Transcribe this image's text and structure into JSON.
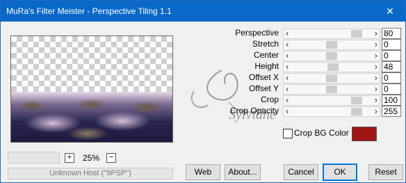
{
  "window": {
    "title": "MuRa's Filter Meister - Perspective Tiling 1.1",
    "close_glyph": "✕"
  },
  "params": [
    {
      "label": "Perspective",
      "value": "80",
      "level": 0.88
    },
    {
      "label": "Stretch",
      "value": "0",
      "level": 0.5
    },
    {
      "label": "Center",
      "value": "0",
      "level": 0.5
    },
    {
      "label": "Height",
      "value": "48",
      "level": 0.52
    },
    {
      "label": "Offset X",
      "value": "0",
      "level": 0.5
    },
    {
      "label": "Offset Y",
      "value": "0",
      "level": 0.5
    },
    {
      "label": "Crop",
      "value": "100",
      "level": 0.88
    },
    {
      "label": "Crop Opacity",
      "value": "255",
      "level": 0.88
    }
  ],
  "crop_bg": {
    "label": "Crop BG Color",
    "checked": false,
    "color": "#9e1414"
  },
  "zoom": {
    "value": "25%",
    "plus": "+",
    "minus": "−"
  },
  "status": "Unknown Host (\"9PSP\")",
  "buttons": {
    "web": "Web",
    "about": "About...",
    "cancel": "Cancel",
    "ok": "OK",
    "reset": "Reset"
  },
  "watermark": "Sylviane",
  "arrows": {
    "left": "‹",
    "right": "›"
  }
}
